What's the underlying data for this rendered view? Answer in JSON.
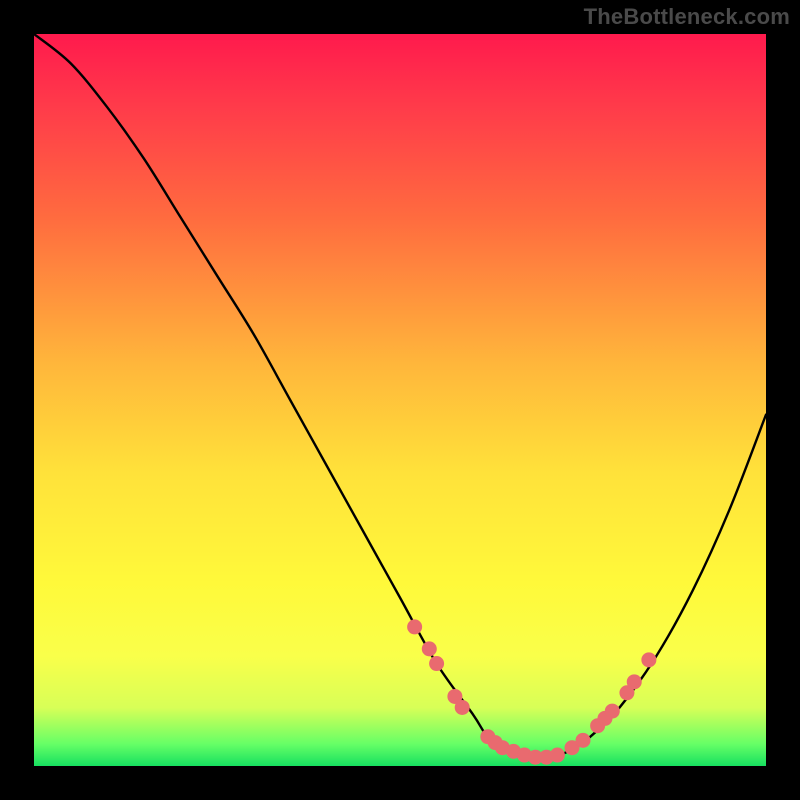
{
  "watermark": "TheBottleneck.com",
  "chart_data": {
    "type": "line",
    "title": "",
    "xlabel": "",
    "ylabel": "",
    "xlim": [
      0,
      100
    ],
    "ylim": [
      0,
      100
    ],
    "series": [
      {
        "name": "bottleneck-curve",
        "x": [
          0,
          5,
          10,
          15,
          20,
          25,
          30,
          35,
          40,
          45,
          50,
          55,
          60,
          62,
          65,
          68,
          70,
          73,
          76,
          80,
          85,
          90,
          95,
          100
        ],
        "y": [
          100,
          96,
          90,
          83,
          75,
          67,
          59,
          50,
          41,
          32,
          23,
          14,
          7,
          4,
          2,
          1,
          1,
          2,
          4,
          8,
          15,
          24,
          35,
          48
        ]
      }
    ],
    "markers": [
      {
        "x": 52,
        "y": 19
      },
      {
        "x": 54,
        "y": 16
      },
      {
        "x": 55,
        "y": 14
      },
      {
        "x": 57.5,
        "y": 9.5
      },
      {
        "x": 58.5,
        "y": 8
      },
      {
        "x": 62,
        "y": 4
      },
      {
        "x": 63,
        "y": 3.2
      },
      {
        "x": 64,
        "y": 2.5
      },
      {
        "x": 65.5,
        "y": 2
      },
      {
        "x": 67,
        "y": 1.5
      },
      {
        "x": 68.5,
        "y": 1.2
      },
      {
        "x": 70,
        "y": 1.2
      },
      {
        "x": 71.5,
        "y": 1.5
      },
      {
        "x": 73.5,
        "y": 2.5
      },
      {
        "x": 75,
        "y": 3.5
      },
      {
        "x": 77,
        "y": 5.5
      },
      {
        "x": 78,
        "y": 6.5
      },
      {
        "x": 79,
        "y": 7.5
      },
      {
        "x": 81,
        "y": 10
      },
      {
        "x": 82,
        "y": 11.5
      },
      {
        "x": 84,
        "y": 14.5
      }
    ],
    "marker_color": "#e96a6f",
    "curve_color": "#000000"
  }
}
